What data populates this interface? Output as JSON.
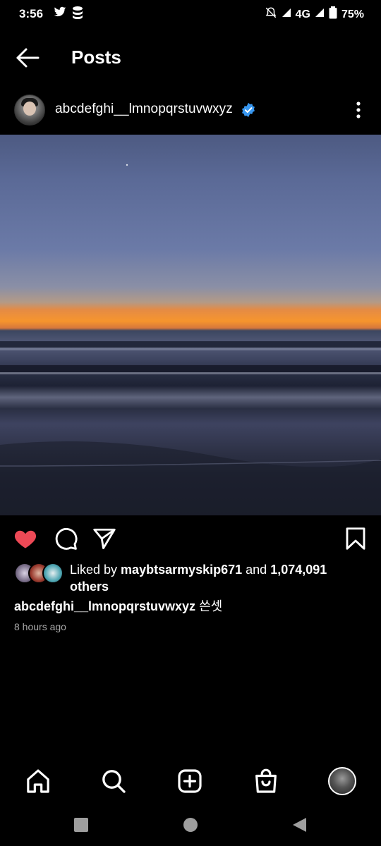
{
  "status_bar": {
    "time": "3:56",
    "network": "4G",
    "battery": "75%",
    "icons": [
      "twitter-icon",
      "stack-icon",
      "mute-icon",
      "signal-icon",
      "battery-icon"
    ]
  },
  "header": {
    "title": "Posts",
    "back_icon": "arrow-left-icon"
  },
  "post": {
    "username": "abcdefghi__lmnopqrstuvwxyz",
    "verified": true,
    "image_alt": "sunset over the ocean",
    "liked_by_prefix": "Liked by ",
    "liked_by_user": "maybtsarmyskip671",
    "liked_by_mid": " and ",
    "liked_by_count": "1,074,091",
    "liked_by_suffix": "others",
    "caption_user": "abcdefghi__lmnopqrstuvwxyz",
    "caption_text": " 쓴셋",
    "time_ago": "8 hours ago",
    "liked": true
  },
  "nav": {
    "items": [
      "home-icon",
      "search-icon",
      "create-icon",
      "shop-icon",
      "profile-avatar"
    ]
  },
  "colors": {
    "like": "#ed4956",
    "verified": "#3897f0",
    "muted_text": "#a8a8a8"
  }
}
